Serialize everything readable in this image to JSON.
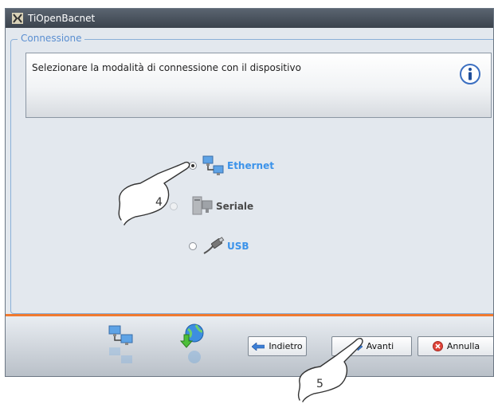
{
  "window": {
    "title": "TiOpenBacnet"
  },
  "group": {
    "legend": "Connessione"
  },
  "info": {
    "text": "Selezionare la modalità di connessione con il dispositivo",
    "icon": "info-icon"
  },
  "options": [
    {
      "label": "Ethernet",
      "selected": true,
      "enabled": true,
      "icon": "network-computers-icon"
    },
    {
      "label": "Seriale",
      "selected": false,
      "enabled": false,
      "icon": "serial-computer-icon"
    },
    {
      "label": "USB",
      "selected": false,
      "enabled": true,
      "icon": "usb-cable-icon"
    }
  ],
  "bottom_icons": [
    "network-computers-icon",
    "globe-download-icon"
  ],
  "buttons": {
    "back": "Indietro",
    "next": "Avanti",
    "cancel": "Annulla"
  },
  "callouts": {
    "step_a": "4",
    "step_b": "5"
  },
  "colors": {
    "accent_orange": "#f07a30",
    "label_blue": "#3c93ea",
    "legend_blue": "#5b8fd1",
    "titlebar": "#3b434d"
  }
}
